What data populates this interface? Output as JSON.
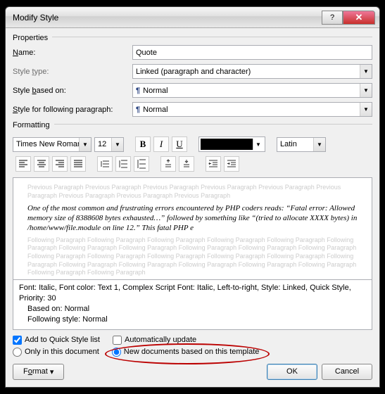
{
  "window": {
    "title": "Modify Style"
  },
  "properties": {
    "section_label": "Properties",
    "name_label": "Name:",
    "name_value": "Quote",
    "type_label": "Style type:",
    "type_value": "Linked (paragraph and character)",
    "based_label": "Style based on:",
    "based_value": "Normal",
    "follow_label": "Style for following paragraph:",
    "follow_value": "Normal"
  },
  "formatting": {
    "section_label": "Formatting",
    "font": "Times New Roman",
    "size": "12",
    "bold": "B",
    "italic": "I",
    "underline": "U",
    "script": "Latin"
  },
  "preview": {
    "prev_text": "Previous Paragraph Previous Paragraph Previous Paragraph Previous Paragraph Previous Paragraph Previous Paragraph Previous Paragraph Previous Paragraph Previous Paragraph",
    "sample": "One of the most common and frustrating errors encountered by PHP coders reads: “Fatal error: Allowed memory size of 8388608 bytes exhausted…” followed by something like “(tried to allocate XXXX bytes) in /home/www/file.module on line 12.” This fatal PHP e",
    "follow_text": "Following Paragraph Following Paragraph Following Paragraph Following Paragraph Following Paragraph Following Paragraph Following Paragraph Following Paragraph Following Paragraph Following Paragraph Following Paragraph Following Paragraph Following Paragraph Following Paragraph Following Paragraph Following Paragraph Following Paragraph Following Paragraph Following Paragraph Following Paragraph Following Paragraph Following Paragraph Following Paragraph Following Paragraph"
  },
  "description": {
    "line1": "Font: Italic, Font color: Text 1, Complex Script Font: Italic, Left-to-right, Style: Linked, Quick Style, Priority: 30",
    "line2": "Based on: Normal",
    "line3": "Following style: Normal"
  },
  "options": {
    "quick_style": "Add to Quick Style list",
    "auto_update": "Automatically update",
    "only_doc": "Only in this document",
    "new_docs": "New documents based on this template"
  },
  "buttons": {
    "format": "Format",
    "ok": "OK",
    "cancel": "Cancel"
  }
}
